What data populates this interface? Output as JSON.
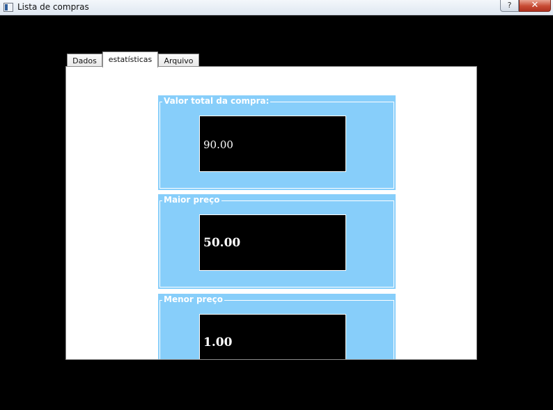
{
  "window": {
    "title": "Lista de compras",
    "help_label": "?",
    "close_label": "✕"
  },
  "tabs": [
    {
      "label": "Dados"
    },
    {
      "label": "estatísticas"
    },
    {
      "label": "Arquivo"
    }
  ],
  "active_tab": "estatísticas",
  "stats": {
    "total": {
      "label": "Valor total da compra:",
      "value": "90.00"
    },
    "max": {
      "label": "Maior preço",
      "value": "50.00"
    },
    "min": {
      "label": "Menor preço",
      "value": "1.00"
    }
  },
  "colors": {
    "group_bg": "#87cefa",
    "value_bg": "#000000",
    "window_bg": "#000000"
  }
}
